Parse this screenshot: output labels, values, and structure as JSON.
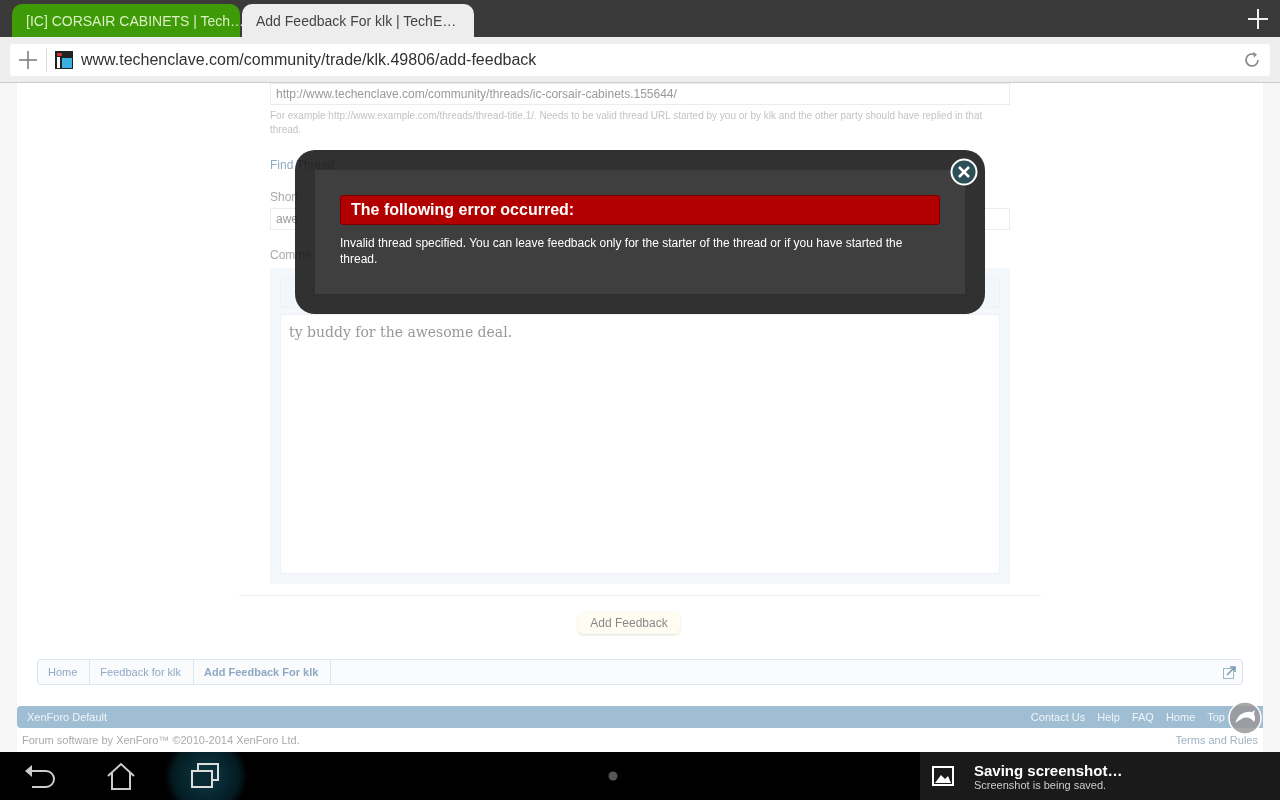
{
  "tabs": [
    {
      "label": "[IC] CORSAIR CABINETS | Tech…",
      "selected": false
    },
    {
      "label": "Add Feedback For klk | TechE…",
      "selected": true
    }
  ],
  "address_bar": {
    "url": "www.techenclave.com/community/trade/klk.49806/add-feedback"
  },
  "form": {
    "thread_url": "http://www.techenclave.com/community/threads/ic-corsair-cabinets.155644/",
    "thread_hint": "For example http://www.example.com/threads/thread-title.1/. Needs to be valid thread URL started by you or by klk and the other party should have replied in that thread.",
    "find_thread": "Find Thread",
    "short_review_label": "Short",
    "short_review": "awe",
    "comments_label": "Comme",
    "comment": "ty buddy for the awesome deal.",
    "submit": "Add Feedback"
  },
  "error_dialog": {
    "title": "The following error occurred:",
    "message": "Invalid thread specified. You can leave feedback only for the starter of the thread or if you have started the thread."
  },
  "breadcrumbs": [
    {
      "label": "Home",
      "selected": false
    },
    {
      "label": "Feedback for klk",
      "selected": false
    },
    {
      "label": "Add Feedback For klk",
      "selected": true
    }
  ],
  "footer": {
    "style": "XenForo Default",
    "links": [
      "Contact Us",
      "Help",
      "FAQ",
      "Home",
      "Top"
    ],
    "copyright": "Forum software by XenForo™ ©2010-2014 XenForo Ltd.",
    "terms": "Terms and Rules"
  },
  "notification": {
    "title": "Saving screenshot…",
    "text": "Screenshot is being saved."
  }
}
